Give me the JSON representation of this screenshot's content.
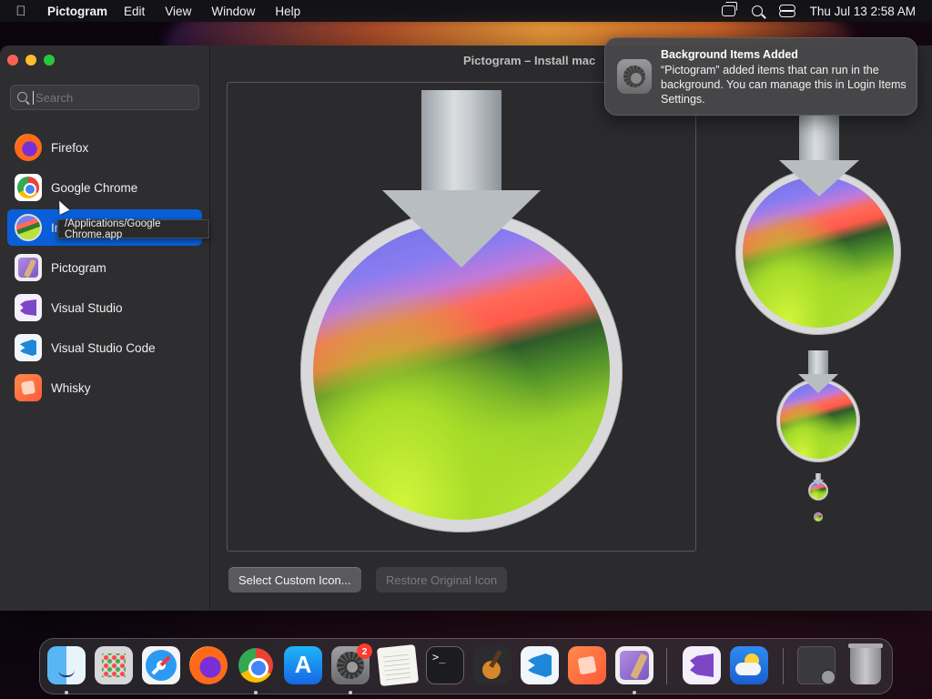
{
  "menubar": {
    "apple": "",
    "app_name": "Pictogram",
    "menus": [
      "Edit",
      "View",
      "Window",
      "Help"
    ],
    "clock": "Thu Jul 13  2:58 AM",
    "status_icons": [
      "screen-mirroring-icon",
      "spotlight-search-icon",
      "control-center-icon"
    ]
  },
  "window": {
    "title": "Pictogram – Install mac",
    "traffic_lights": [
      "#fe5f57",
      "#febc2e",
      "#28c840"
    ]
  },
  "sidebar": {
    "search": {
      "placeholder": "Search",
      "value": ""
    },
    "items": [
      {
        "label": "Firefox",
        "icon": "firefox-icon"
      },
      {
        "label": "Google Chrome",
        "icon": "chrome-icon"
      },
      {
        "label": "In",
        "icon": "macos-installer-icon",
        "selected": true
      },
      {
        "label": "Pictogram",
        "icon": "pictogram-icon"
      },
      {
        "label": "Visual Studio",
        "icon": "visual-studio-icon"
      },
      {
        "label": "Visual Studio Code",
        "icon": "vscode-icon"
      },
      {
        "label": "Whisky",
        "icon": "whisky-icon"
      }
    ],
    "tooltip": "/Applications/Google Chrome.app",
    "selected_color": "#0a5fd8"
  },
  "main": {
    "buttons": {
      "select_custom": "Select Custom Icon...",
      "restore_original": "Restore Original Icon"
    }
  },
  "notification": {
    "title": "Background Items Added",
    "body": "“Pictogram” added items that can run in the background. You can manage this in Login Items Settings.",
    "icon": "system-settings-icon"
  },
  "dock": {
    "items": [
      {
        "name": "finder",
        "running": true
      },
      {
        "name": "launchpad",
        "running": false
      },
      {
        "name": "safari",
        "running": false
      },
      {
        "name": "firefox",
        "running": false
      },
      {
        "name": "chrome",
        "running": true
      },
      {
        "name": "app-store",
        "running": false
      },
      {
        "name": "system-settings",
        "running": true,
        "badge": "2"
      },
      {
        "name": "textedit",
        "running": false
      },
      {
        "name": "terminal",
        "running": false
      },
      {
        "name": "garageband",
        "running": false
      },
      {
        "name": "vscode",
        "running": false
      },
      {
        "name": "whisky",
        "running": false
      },
      {
        "name": "pictogram",
        "running": true
      },
      {
        "name": "visual-studio",
        "running": false
      },
      {
        "name": "weather",
        "running": false
      },
      {
        "name": "downloads-stack",
        "running": false
      },
      {
        "name": "trash",
        "running": false
      }
    ]
  }
}
